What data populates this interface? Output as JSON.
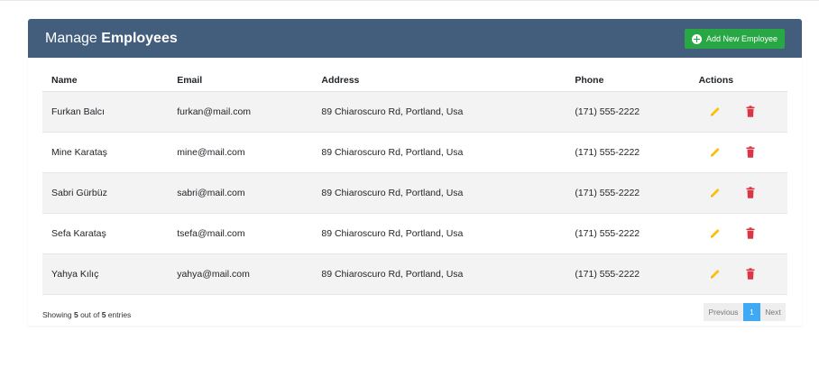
{
  "header": {
    "title_prefix": "Manage ",
    "title_bold": "Employees",
    "add_button_label": "Add New Employee"
  },
  "table": {
    "columns": [
      "Name",
      "Email",
      "Address",
      "Phone",
      "Actions"
    ],
    "rows": [
      {
        "name": "Furkan Balcı",
        "email": "furkan@mail.com",
        "address": "89 Chiaroscuro Rd, Portland, Usa",
        "phone": "(171) 555-2222"
      },
      {
        "name": "Mine Karataş",
        "email": "mine@mail.com",
        "address": "89 Chiaroscuro Rd, Portland, Usa",
        "phone": "(171) 555-2222"
      },
      {
        "name": "Sabri Gürbüz",
        "email": "sabri@mail.com",
        "address": "89 Chiaroscuro Rd, Portland, Usa",
        "phone": "(171) 555-2222"
      },
      {
        "name": "Sefa Karataş",
        "email": "tsefa@mail.com",
        "address": "89 Chiaroscuro Rd, Portland, Usa",
        "phone": "(171) 555-2222"
      },
      {
        "name": "Yahya Kılıç",
        "email": "yahya@mail.com",
        "address": "89 Chiaroscuro Rd, Portland, Usa",
        "phone": "(171) 555-2222"
      }
    ]
  },
  "footer": {
    "showing_prefix": "Showing ",
    "shown_count": "5",
    "middle": " out of ",
    "total_count": "5",
    "suffix": " entries"
  },
  "pagination": {
    "previous_label": "Previous",
    "current_page": "1",
    "next_label": "Next"
  },
  "colors": {
    "header_bg": "#435d7d",
    "add_button": "#28a745",
    "edit_icon": "#ffc107",
    "delete_icon": "#dc3545",
    "active_page": "#3fa9f5"
  },
  "icons": {
    "add": "plus-circle-icon",
    "edit": "pencil-icon",
    "delete": "trash-icon"
  }
}
